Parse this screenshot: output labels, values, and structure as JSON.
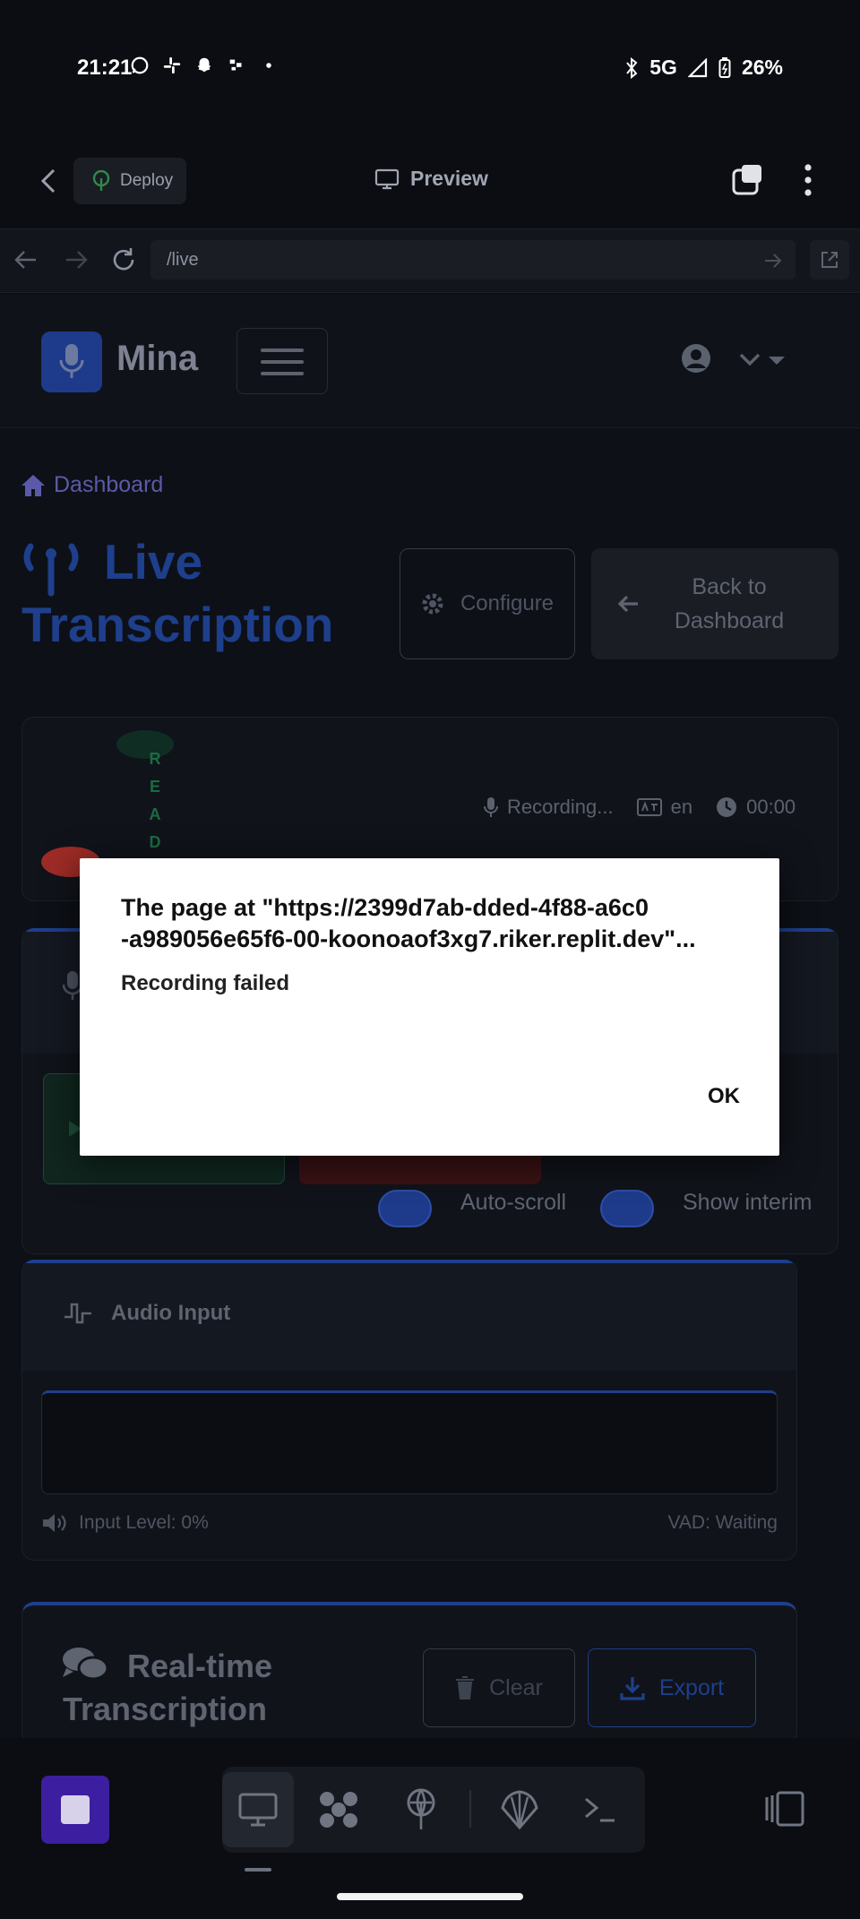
{
  "status_bar": {
    "time": "21:21",
    "network": "5G",
    "battery": "26%",
    "notification_icons": [
      "whatsapp-icon",
      "slack-icon",
      "snapchat-icon",
      "app-icon",
      "dot-icon"
    ]
  },
  "app_header": {
    "deploy_label": "Deploy",
    "preview_label": "Preview"
  },
  "url_bar": {
    "url": "/live"
  },
  "webpage": {
    "brand": "Mina",
    "breadcrumb": "Dashboard",
    "title": "Live Transcription",
    "configure_label": "Configure",
    "back_label": "Back to Dashboard",
    "status": {
      "ready_letters": [
        "R",
        "E",
        "A",
        "D"
      ],
      "recording": "Recording...",
      "language": "en",
      "timer": "00:00"
    },
    "toggles": {
      "autoscroll": "Auto-scroll",
      "show_interim": "Show interim"
    },
    "audio": {
      "title": "Audio Input",
      "input_level": "Input Level: 0%",
      "vad": "VAD: Waiting"
    },
    "transcription": {
      "title": "Real-time Transcription",
      "clear_label": "Clear",
      "export_label": "Export"
    }
  },
  "dialog": {
    "title": "The page at \"https://2399d7ab-dded-4f88-a6c0-a989056e65f6-00-koonoaof3xg7.riker.replit.dev\"...",
    "title_line1": "The page at \"https://2399d7ab-dded-4f88-a6c0",
    "title_line2": "-a989056e65f6-00-koonoaof3xg7.riker.replit.dev\"...",
    "message": "Recording failed",
    "ok_label": "OK"
  },
  "colors": {
    "accent": "#1e3f8c",
    "background": "#0b0d12",
    "record_red": "#9d2b26",
    "ready_green": "#1b6a42",
    "stop_purple": "#3b1fa0"
  }
}
